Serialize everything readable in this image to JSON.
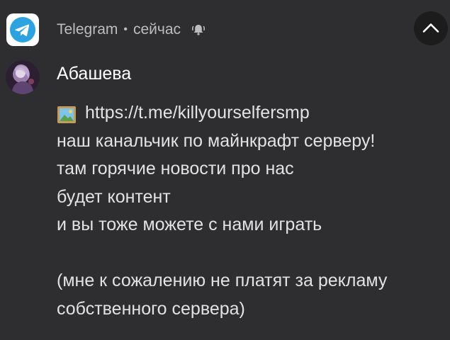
{
  "header": {
    "app_name": "Telegram",
    "separator": "•",
    "time": "сейчас"
  },
  "notification": {
    "sender": "Абашева",
    "lines": [
      "https://t.me/killyourselfersmp",
      "наш канальчик по майнкрафт серверу!",
      "там горячие новости про нас",
      "будет контент",
      "и вы тоже можете с нами играть",
      "",
      "(мне к сожалению не платят за рекламу",
      "собственного сервера)"
    ]
  },
  "icons": {
    "app": "telegram-icon",
    "bell": "bell-ringing-icon",
    "expand": "chevron-up-icon",
    "link_emoji": "framed-picture-icon"
  },
  "colors": {
    "background": "#2e2e30",
    "telegram_blue": "#2aa3e0",
    "text_primary": "#ffffff",
    "text_secondary": "#bdbdbd"
  }
}
